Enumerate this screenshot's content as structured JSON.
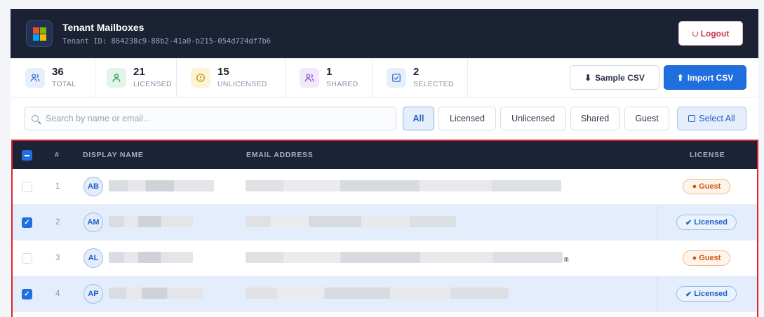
{
  "header": {
    "title": "Tenant Mailboxes",
    "tenant_id": "Tenant ID: 864238c9-88b2-41a0-b215-054d724df7b6",
    "logout_label": "Logout",
    "logo_colors": [
      "#f25022",
      "#7fba00",
      "#00a4ef",
      "#ffb900"
    ]
  },
  "stats": [
    {
      "value": "36",
      "label": "TOTAL",
      "icon": "users-icon",
      "color": "#3b6fd4",
      "bg": "#e7effb"
    },
    {
      "value": "21",
      "label": "LICENSED",
      "icon": "user-check-icon",
      "color": "#2e9a55",
      "bg": "#e3f5e9"
    },
    {
      "value": "15",
      "label": "UNLICENSED",
      "icon": "alert-icon",
      "color": "#c99410",
      "bg": "#fdf3d6"
    },
    {
      "value": "1",
      "label": "SHARED",
      "icon": "shared-users-icon",
      "color": "#8a4fd0",
      "bg": "#f1e9fb"
    },
    {
      "value": "2",
      "label": "SELECTED",
      "icon": "checkbox-icon",
      "color": "#3b6fd4",
      "bg": "#e7effb"
    }
  ],
  "actions": {
    "sample_csv": "Sample CSV",
    "import_csv": "Import CSV"
  },
  "search": {
    "placeholder": "Search by name or email...",
    "value": ""
  },
  "filters": {
    "all": "All",
    "licensed": "Licensed",
    "unlicensed": "Unlicensed",
    "shared": "Shared",
    "guest": "Guest",
    "select_all": "Select All",
    "active": "All"
  },
  "table": {
    "columns": {
      "index": "#",
      "display_name": "DISPLAY NAME",
      "email": "EMAIL ADDRESS",
      "license": "LICENSE"
    },
    "rows": [
      {
        "index": "1",
        "initials": "AB",
        "selected": false,
        "license": "Guest",
        "email_tail": ""
      },
      {
        "index": "2",
        "initials": "AM",
        "selected": true,
        "license": "Licensed",
        "email_tail": ""
      },
      {
        "index": "3",
        "initials": "AL",
        "selected": false,
        "license": "Guest",
        "email_tail": "m"
      },
      {
        "index": "4",
        "initials": "AP",
        "selected": true,
        "license": "Licensed",
        "email_tail": ""
      }
    ]
  }
}
